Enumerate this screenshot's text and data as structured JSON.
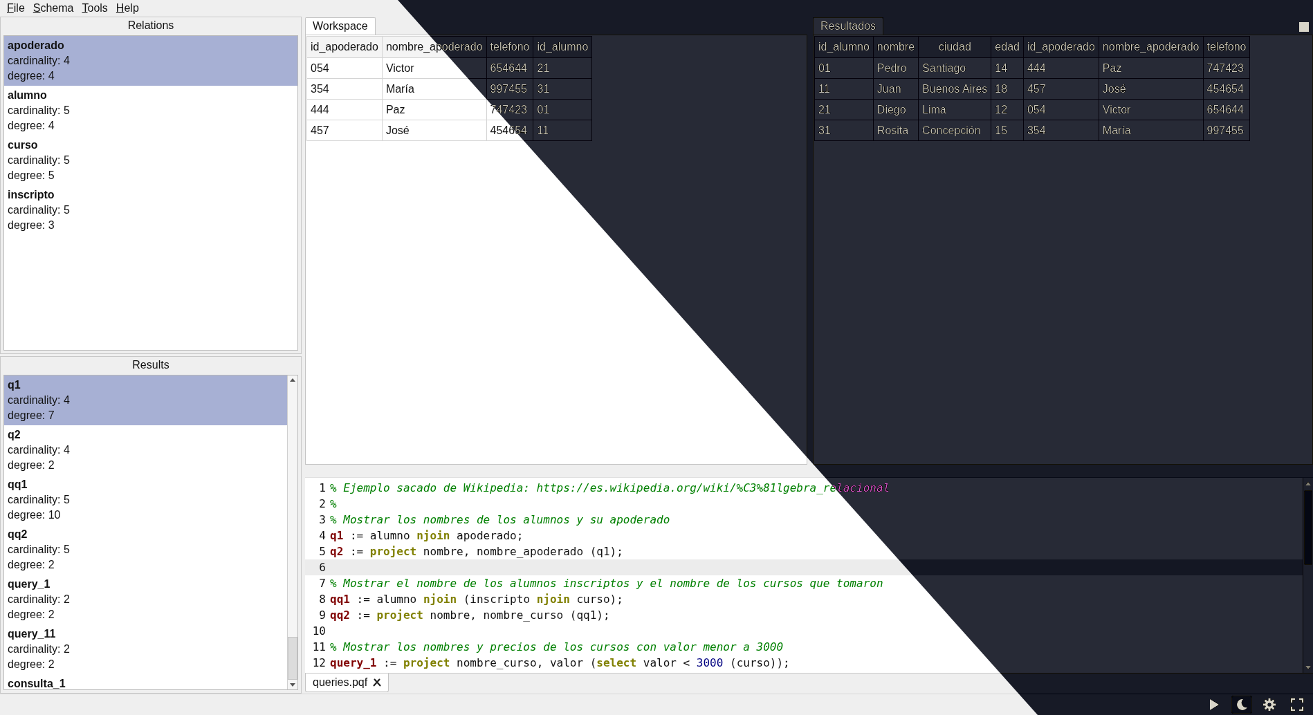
{
  "menu": [
    "File",
    "Schema",
    "Tools",
    "Help"
  ],
  "relations": {
    "title": "Relations",
    "items": [
      {
        "name": "apoderado",
        "lines": [
          "cardinality: 4",
          "degree: 4"
        ],
        "selected": true
      },
      {
        "name": "alumno",
        "lines": [
          "cardinality: 5",
          "degree: 4"
        ],
        "selected": false
      },
      {
        "name": "curso",
        "lines": [
          "cardinality: 5",
          "degree: 5"
        ],
        "selected": false
      },
      {
        "name": "inscripto",
        "lines": [
          "cardinality: 5",
          "degree: 3"
        ],
        "selected": false
      }
    ]
  },
  "results": {
    "title": "Results",
    "items": [
      {
        "name": "q1",
        "lines": [
          "cardinality: 4",
          "degree: 7"
        ],
        "selected": true
      },
      {
        "name": "q2",
        "lines": [
          "cardinality: 4",
          "degree: 2"
        ],
        "selected": false
      },
      {
        "name": "qq1",
        "lines": [
          "cardinality: 5",
          "degree: 10"
        ],
        "selected": false
      },
      {
        "name": "qq2",
        "lines": [
          "cardinality: 5",
          "degree: 2"
        ],
        "selected": false
      },
      {
        "name": "query_1",
        "lines": [
          "cardinality: 2",
          "degree: 2"
        ],
        "selected": false
      },
      {
        "name": "query_11",
        "lines": [
          "cardinality: 2",
          "degree: 2"
        ],
        "selected": false
      },
      {
        "name": "consulta_1",
        "selected": false
      }
    ]
  },
  "workspace": {
    "tab": {
      "label": "Workspace",
      "selected": true
    },
    "table": {
      "columns": [
        "id_apoderado",
        "nombre_apoderado",
        "telefono",
        "id_alumno"
      ],
      "rows": [
        [
          "054",
          "Victor",
          "654644",
          "21"
        ],
        [
          "354",
          "María",
          "997455",
          "31"
        ],
        [
          "444",
          "Paz",
          "747423",
          "01"
        ],
        [
          "457",
          "José",
          "454654",
          "11"
        ]
      ]
    }
  },
  "resultados": {
    "tab": {
      "label": "Resultados",
      "selected": true
    },
    "table": {
      "columns": [
        "id_alumno",
        "nombre",
        "ciudad",
        "edad",
        "id_apoderado",
        "nombre_apoderado",
        "telefono"
      ],
      "rows": [
        [
          "01",
          "Pedro",
          "Santiago",
          "14",
          "444",
          "Paz",
          "747423"
        ],
        [
          "11",
          "Juan",
          "Buenos Aires",
          "18",
          "457",
          "José",
          "454654"
        ],
        [
          "21",
          "Diego",
          "Lima",
          "12",
          "054",
          "Victor",
          "654644"
        ],
        [
          "31",
          "Rosita",
          "Concepción",
          "15",
          "354",
          "María",
          "997455"
        ]
      ]
    }
  },
  "editor": {
    "lines": [
      {
        "number": "1",
        "current": false,
        "tokens": [
          {
            "kind": "comment",
            "text": "% Ejemplo sacado de Wikipedia: https://es.wikipedia.org/wiki/%C3%81lgebra_relacional"
          }
        ]
      },
      {
        "number": "2",
        "current": false,
        "tokens": [
          {
            "kind": "comment",
            "text": "%"
          }
        ]
      },
      {
        "number": "3",
        "current": false,
        "tokens": [
          {
            "kind": "comment",
            "text": "% Mostrar los nombres de los alumnos y su apoderado"
          }
        ]
      },
      {
        "number": "4",
        "current": false,
        "tokens": [
          {
            "kind": "target",
            "text": "q1"
          },
          {
            "kind": "plain",
            "text": " := alumno "
          },
          {
            "kind": "keyword",
            "text": "njoin"
          },
          {
            "kind": "plain",
            "text": " apoderado;"
          }
        ]
      },
      {
        "number": "5",
        "current": false,
        "tokens": [
          {
            "kind": "target",
            "text": "q2"
          },
          {
            "kind": "plain",
            "text": " := "
          },
          {
            "kind": "keyword",
            "text": "project"
          },
          {
            "kind": "plain",
            "text": " nombre, nombre_apoderado (q1);"
          }
        ]
      },
      {
        "number": "6",
        "current": true
      },
      {
        "number": "7",
        "current": false,
        "tokens": [
          {
            "kind": "comment",
            "text": "% Mostrar el nombre de los alumnos inscriptos y el nombre de los cursos que tomaron"
          }
        ]
      },
      {
        "number": "8",
        "current": false,
        "tokens": [
          {
            "kind": "target",
            "text": "qq1"
          },
          {
            "kind": "plain",
            "text": " := alumno "
          },
          {
            "kind": "keyword",
            "text": "njoin"
          },
          {
            "kind": "plain",
            "text": " (inscripto "
          },
          {
            "kind": "keyword",
            "text": "njoin"
          },
          {
            "kind": "plain",
            "text": " curso);"
          }
        ]
      },
      {
        "number": "9",
        "current": false,
        "tokens": [
          {
            "kind": "target",
            "text": "qq2"
          },
          {
            "kind": "plain",
            "text": " := "
          },
          {
            "kind": "keyword",
            "text": "project"
          },
          {
            "kind": "plain",
            "text": " nombre, nombre_curso (qq1);"
          }
        ]
      },
      {
        "number": "10",
        "current": false
      },
      {
        "number": "11",
        "current": false,
        "tokens": [
          {
            "kind": "comment",
            "text": "% Mostrar los nombres y precios de los cursos con valor menor a 3000"
          }
        ]
      },
      {
        "number": "12",
        "current": false,
        "tokens": [
          {
            "kind": "target",
            "text": "query_1"
          },
          {
            "kind": "plain",
            "text": " := "
          },
          {
            "kind": "keyword",
            "text": "project"
          },
          {
            "kind": "plain",
            "text": " nombre_curso, valor ("
          },
          {
            "kind": "keyword",
            "text": "select"
          },
          {
            "kind": "plain",
            "text": " valor < "
          },
          {
            "kind": "number",
            "text": "3000"
          },
          {
            "kind": "plain",
            "text": " (curso));"
          }
        ]
      }
    ]
  },
  "file_tabs": [
    {
      "label": "queries.pqf",
      "selected": true
    }
  ],
  "status_bar": {
    "buttons": [
      {
        "kind": "run",
        "on": false
      },
      {
        "kind": "theme",
        "on": true
      },
      {
        "kind": "settings",
        "on": false
      },
      {
        "kind": "fullscreen",
        "on": false
      }
    ]
  }
}
